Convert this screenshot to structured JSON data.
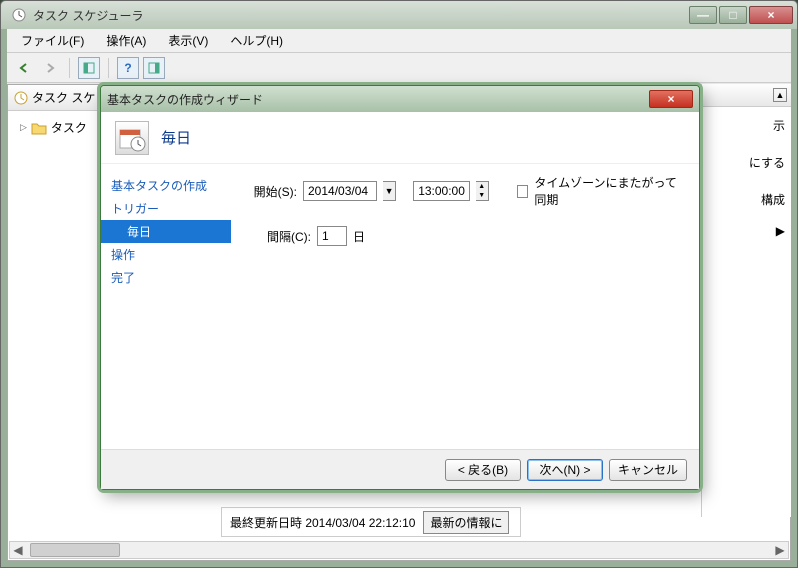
{
  "window": {
    "title": "タスク スケジューラ",
    "min": "—",
    "max": "□",
    "close": "×"
  },
  "menu": {
    "file": "ファイル(F)",
    "action": "操作(A)",
    "view": "表示(V)",
    "help": "ヘルプ(H)"
  },
  "tree": {
    "root": "タスク スケ",
    "child": "タスク"
  },
  "right": {
    "i1": "示",
    "i2": "にする",
    "i3": "構成"
  },
  "status": {
    "label": "最終更新日時 2014/03/04 22:12:10",
    "refresh": "最新の情報に"
  },
  "wizard": {
    "title": "基本タスクの作成ウィザード",
    "headerTitle": "毎日",
    "nav": {
      "i0": "基本タスクの作成",
      "i1": "トリガー",
      "i2": "毎日",
      "i3": "操作",
      "i4": "完了"
    },
    "form": {
      "startLabel": "開始(S):",
      "date": "2014/03/04",
      "time": "13:00:00",
      "tzLabel": "タイムゾーンにまたがって同期",
      "intervalLabel": "間隔(C):",
      "intervalValue": "1",
      "intervalUnit": "日"
    },
    "buttons": {
      "back": "< 戻る(B)",
      "next": "次へ(N) >",
      "cancel": "キャンセル"
    },
    "close": "×"
  }
}
